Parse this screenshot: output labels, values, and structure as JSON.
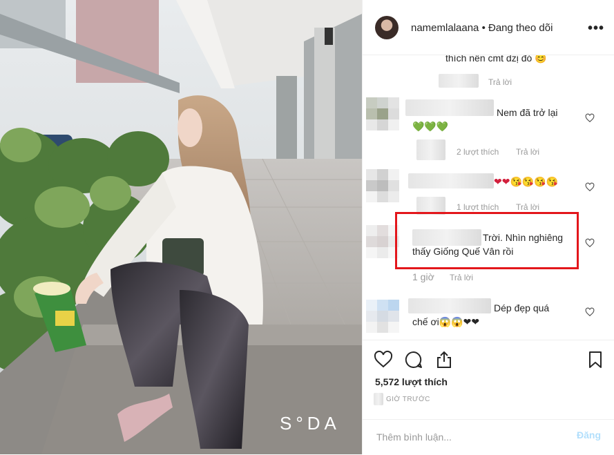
{
  "post": {
    "watermark": "S°DA"
  },
  "header": {
    "username": "namemlalaana",
    "separator": " • ",
    "follow_status": "Đang theo dõi",
    "more_icon": "more-icon"
  },
  "comments": [
    {
      "text": "thích nên cmt dzị đó 😊",
      "reply_label": "Trả lời"
    },
    {
      "text": "Nem đã trở lại",
      "emoji": "💚💚💚",
      "likes": "2 lượt thích",
      "reply_label": "Trả lời"
    },
    {
      "text": "❤❤😘😘😘😘",
      "likes": "1 lượt thích",
      "reply_label": "Trả lời"
    },
    {
      "text": "Trời. Nhìn nghiêng thấy Giống Quế Vân rồi",
      "time": "1 giờ",
      "reply_label": "Trả lời"
    },
    {
      "text": "Dép đẹp quá",
      "text2": "chế ơi😱😱❤❤"
    }
  ],
  "actions": {
    "likes": "5,572 lượt thích",
    "time": "GIỜ TRƯỚC",
    "comment_placeholder": "Thêm bình luận...",
    "post_label": "Đăng"
  },
  "colors": {
    "highlight": "#e3161b",
    "link_disabled": "#b2dffc",
    "muted": "#999999"
  }
}
